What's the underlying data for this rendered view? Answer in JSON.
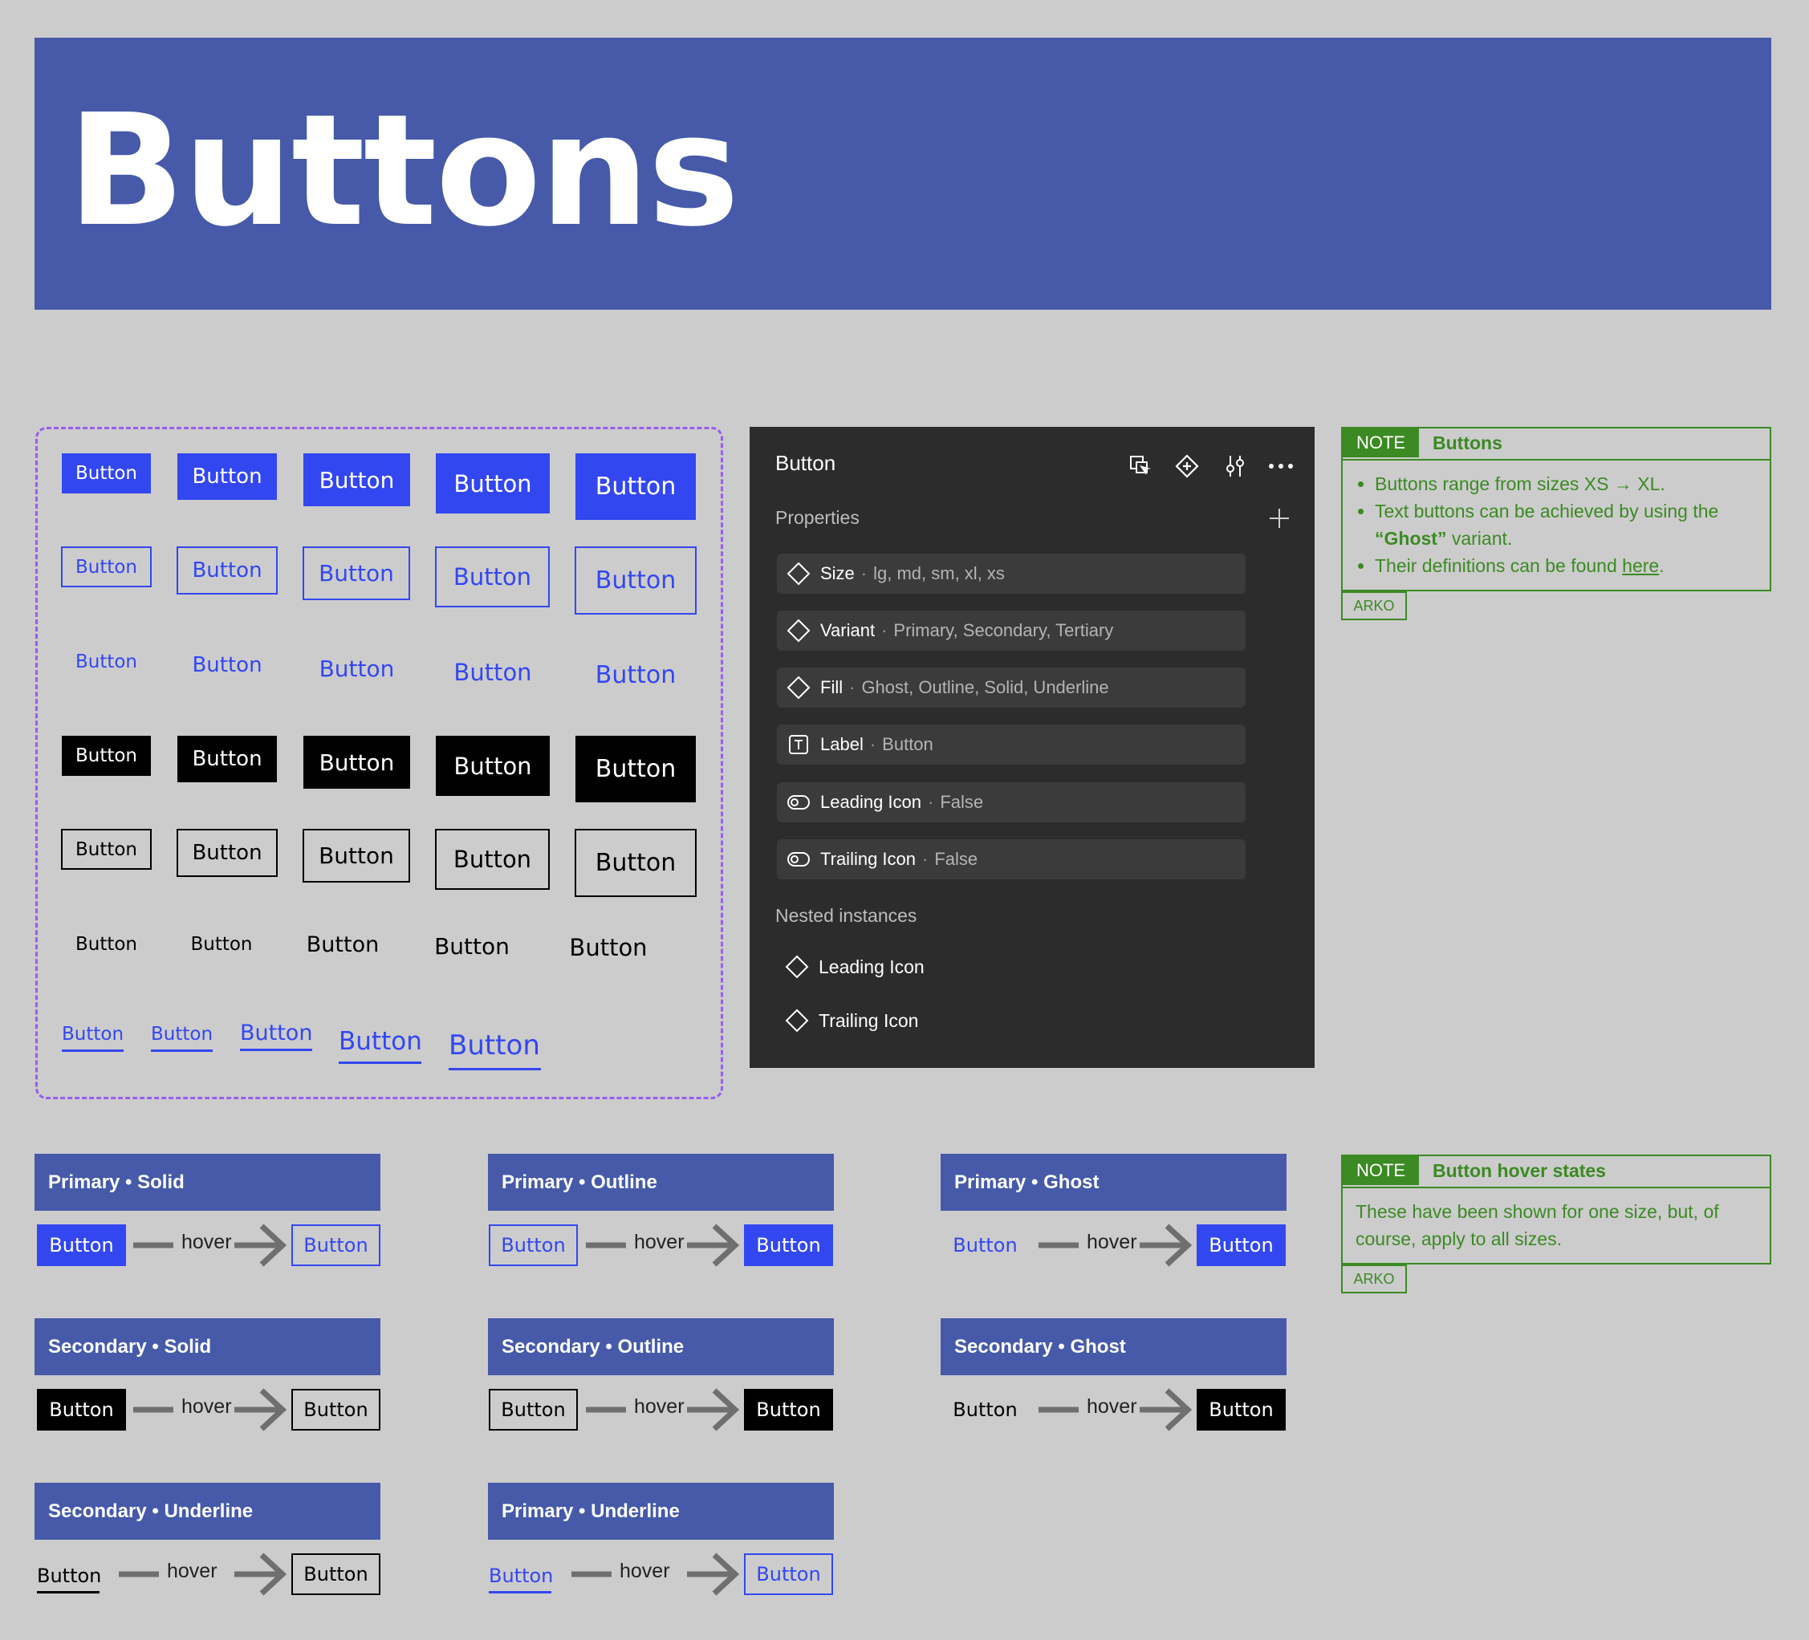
{
  "page": {
    "title": "Buttons"
  },
  "variant_grid": {
    "label": "Button",
    "rows": [
      [
        "Button",
        "Button",
        "Button",
        "Button",
        "Button"
      ],
      [
        "Button",
        "Button",
        "Button",
        "Button",
        "Button"
      ],
      [
        "Button",
        "Button",
        "Button",
        "Button",
        "Button"
      ],
      [
        "Button",
        "Button",
        "Button",
        "Button",
        "Button"
      ],
      [
        "Button",
        "Button",
        "Button",
        "Button",
        "Button"
      ],
      [
        "Button",
        "Button",
        "Button",
        "Button",
        "Button"
      ],
      [
        "Button",
        "Button",
        "Button",
        "Button",
        "Button"
      ]
    ]
  },
  "panel": {
    "title": "Button",
    "properties_label": "Properties",
    "properties": [
      {
        "name": "Size",
        "value": "lg, md, sm, xl, xs",
        "icon": "diamond-icon"
      },
      {
        "name": "Variant",
        "value": "Primary, Secondary, Tertiary",
        "icon": "diamond-icon"
      },
      {
        "name": "Fill",
        "value": "Ghost, Outline, Solid, Underline",
        "icon": "diamond-icon"
      },
      {
        "name": "Label",
        "value": "Button",
        "icon": "text-icon"
      },
      {
        "name": "Leading Icon",
        "value": "False",
        "icon": "toggle-icon"
      },
      {
        "name": "Trailing Icon",
        "value": "False",
        "icon": "toggle-icon"
      }
    ],
    "separator": "·",
    "nested_label": "Nested instances",
    "nested": [
      "Leading Icon",
      "Trailing Icon"
    ]
  },
  "note1": {
    "tag": "NOTE",
    "title": "Buttons",
    "line1": "Buttons range from sizes XS → XL.",
    "line2_pre": "Text buttons can be achieved by using the ",
    "line2_bold": "“Ghost”",
    "line2_post": " variant.",
    "line3_pre": "Their definitions can be found ",
    "line3_link": "here",
    "line3_post": ".",
    "author": "ARKO"
  },
  "note2": {
    "tag": "NOTE",
    "title": "Button hover states",
    "body": "These have been shown for one size, but, of course, apply to all sizes.",
    "author": "ARKO"
  },
  "hover_states": {
    "hover_label": "hover",
    "button_label": "Button",
    "items": [
      {
        "title": "Primary • Solid"
      },
      {
        "title": "Primary • Outline"
      },
      {
        "title": "Primary • Ghost"
      },
      {
        "title": "Secondary • Solid"
      },
      {
        "title": "Secondary • Outline"
      },
      {
        "title": "Secondary • Ghost"
      },
      {
        "title": "Secondary • Underline"
      },
      {
        "title": "Primary • Underline"
      }
    ]
  },
  "colors": {
    "header": "#465aa9",
    "primary": "#3347f0",
    "secondary": "#000000",
    "panel": "#2c2c2c",
    "note": "#3b8a23",
    "frame": "#9a5cf0"
  }
}
